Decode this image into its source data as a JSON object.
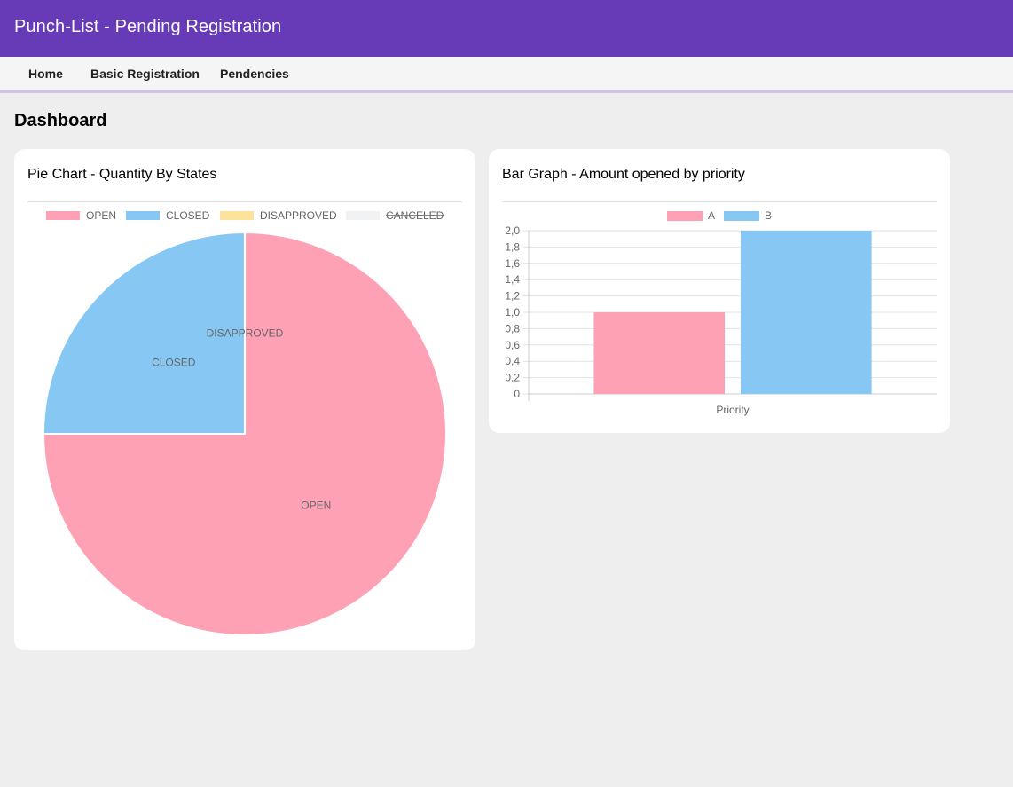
{
  "app": {
    "title": "Punch-List - Pending Registration"
  },
  "nav": {
    "items": [
      "Home",
      "Basic Registration",
      "Pendencies"
    ]
  },
  "page": {
    "heading": "Dashboard"
  },
  "pie_card": {
    "title": "Pie Chart - Quantity By States"
  },
  "bar_card": {
    "title": "Bar Graph - Amount opened by priority"
  },
  "chart_data": [
    {
      "type": "pie",
      "title": "Pie Chart - Quantity By States",
      "categories": [
        "OPEN",
        "CLOSED",
        "DISAPPROVED",
        "CANCELED"
      ],
      "values": [
        3,
        1,
        0,
        0
      ],
      "colors": [
        "#ffa1b5",
        "#86c7f3",
        "#ffe29a",
        "#f1f2f4"
      ],
      "hidden": [
        false,
        false,
        false,
        true
      ],
      "legend": "top"
    },
    {
      "type": "bar",
      "title": "Bar Graph - Amount opened by priority",
      "categories": [
        "Priority"
      ],
      "series": [
        {
          "name": "A",
          "values": [
            1
          ],
          "color": "#ffa1b5"
        },
        {
          "name": "B",
          "values": [
            2
          ],
          "color": "#86c7f3"
        }
      ],
      "xlabel": "Priority",
      "ylabel": "",
      "ylim": [
        0,
        2
      ],
      "yticks": [
        "0",
        "0,2",
        "0,4",
        "0,6",
        "0,8",
        "1,0",
        "1,2",
        "1,4",
        "1,6",
        "1,8",
        "2,0"
      ],
      "grid": true,
      "legend": "top"
    }
  ]
}
